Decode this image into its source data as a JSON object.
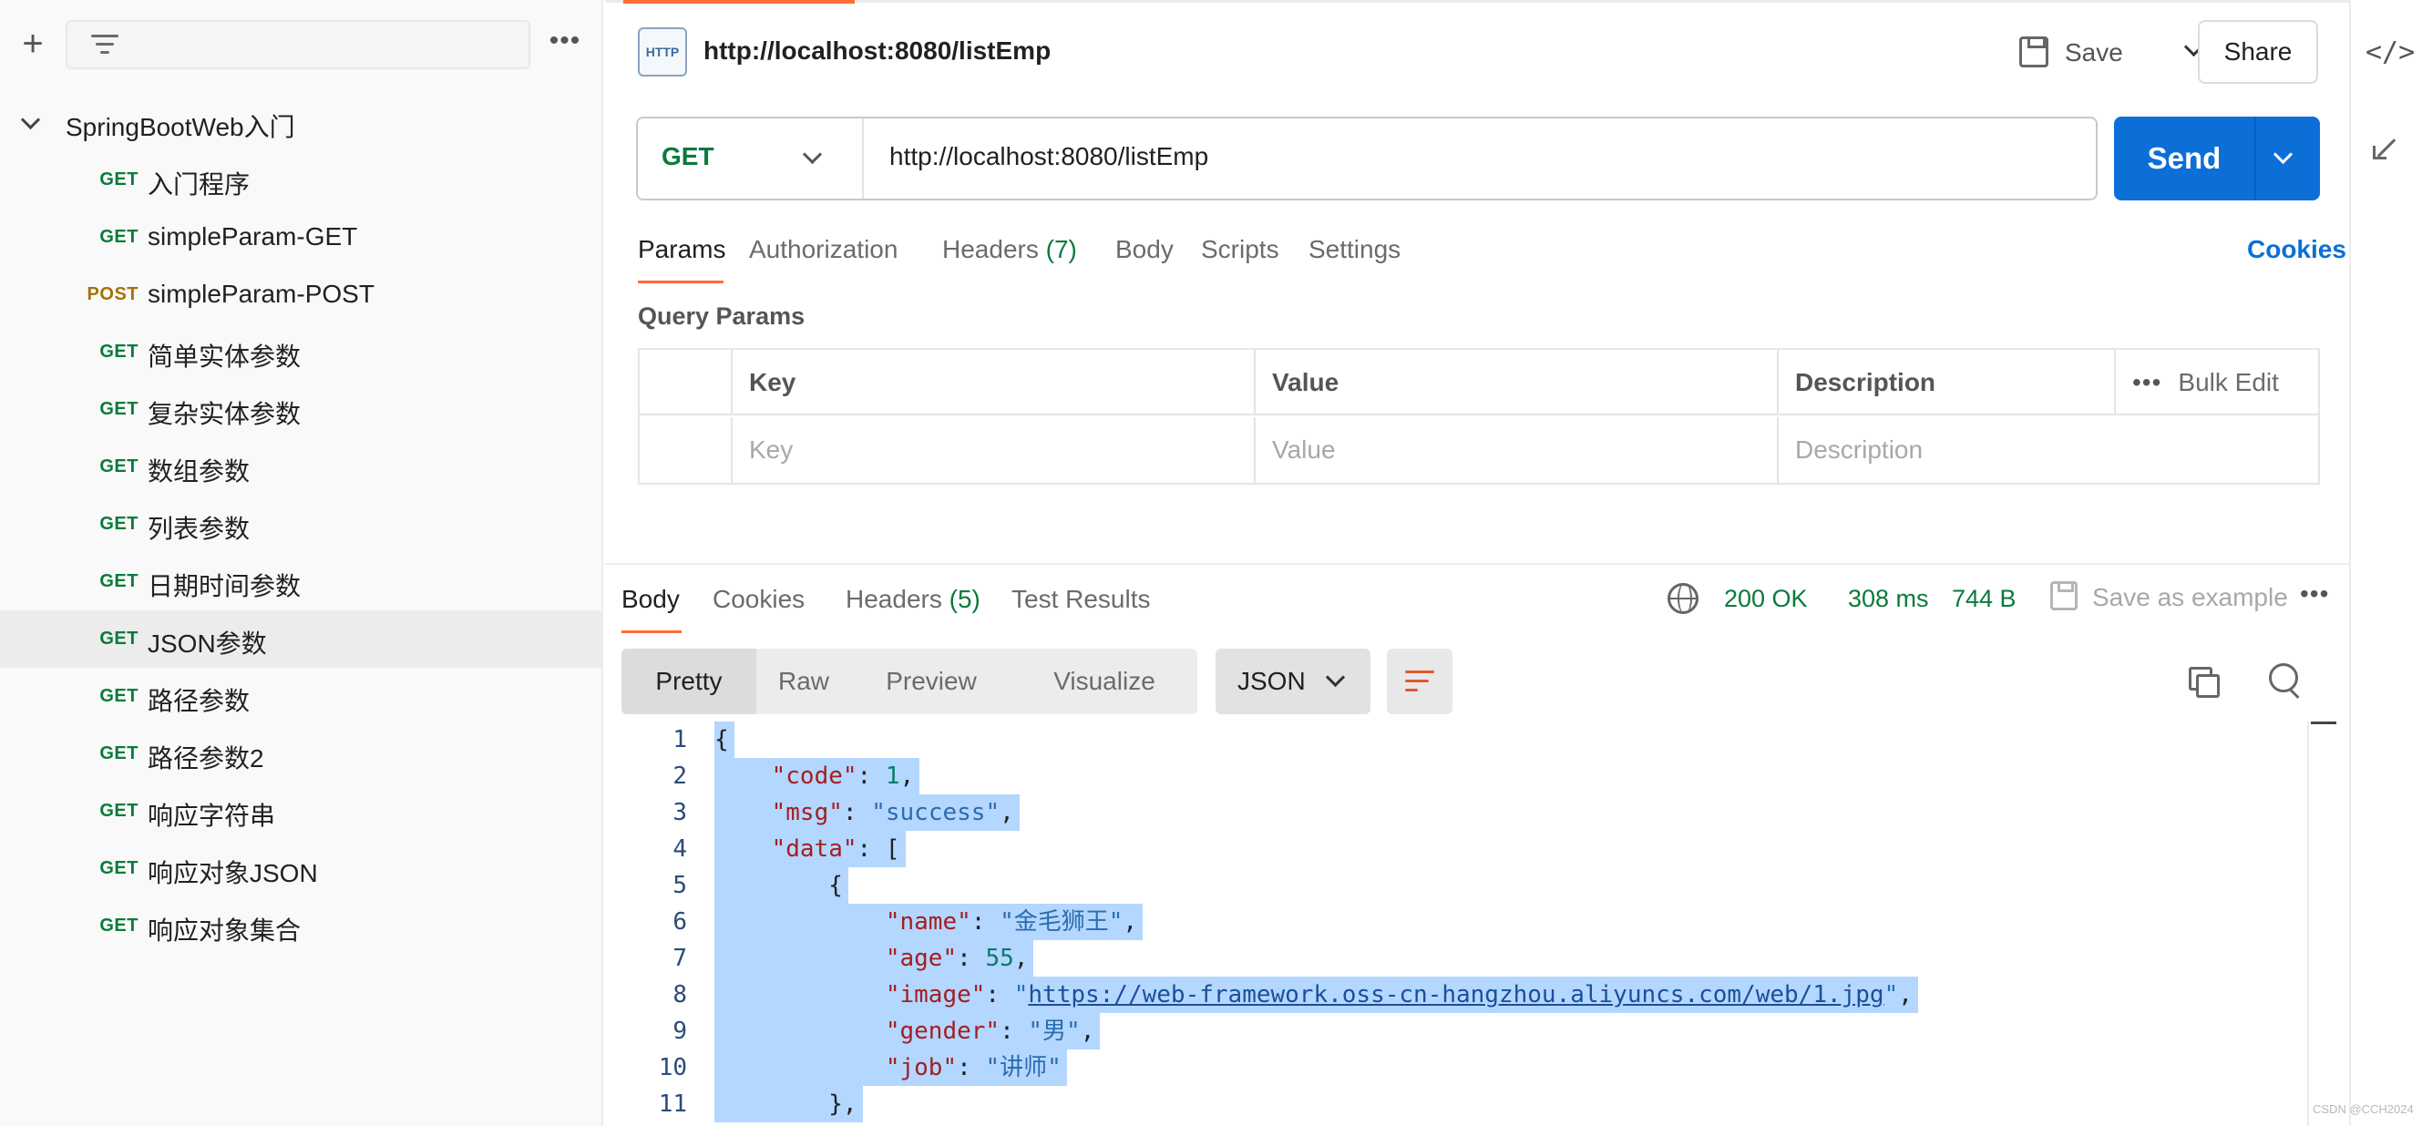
{
  "sidebar": {
    "collection_name": "SpringBootWeb入门",
    "items": [
      {
        "method": "GET",
        "name": "入门程序"
      },
      {
        "method": "GET",
        "name": "simpleParam-GET"
      },
      {
        "method": "POST",
        "name": "simpleParam-POST"
      },
      {
        "method": "GET",
        "name": "简单实体参数"
      },
      {
        "method": "GET",
        "name": "复杂实体参数"
      },
      {
        "method": "GET",
        "name": "数组参数"
      },
      {
        "method": "GET",
        "name": "列表参数"
      },
      {
        "method": "GET",
        "name": "日期时间参数"
      },
      {
        "method": "GET",
        "name": "JSON参数"
      },
      {
        "method": "GET",
        "name": "路径参数"
      },
      {
        "method": "GET",
        "name": "路径参数2"
      },
      {
        "method": "GET",
        "name": "响应字符串"
      },
      {
        "method": "GET",
        "name": "响应对象JSON"
      },
      {
        "method": "GET",
        "name": "响应对象集合"
      }
    ],
    "active_item": "JSON参数"
  },
  "header": {
    "icon_label": "HTTP",
    "title": "http://localhost:8080/listEmp",
    "save_label": "Save",
    "share_label": "Share"
  },
  "request": {
    "method": "GET",
    "url": "http://localhost:8080/listEmp",
    "send_label": "Send",
    "tabs": {
      "params": "Params",
      "authorization": "Authorization",
      "headers": "Headers",
      "headers_count": "(7)",
      "body": "Body",
      "scripts": "Scripts",
      "settings": "Settings",
      "cookies": "Cookies"
    }
  },
  "query_params": {
    "title": "Query Params",
    "columns": {
      "key": "Key",
      "value": "Value",
      "description": "Description",
      "bulk_edit": "Bulk Edit"
    },
    "placeholders": {
      "key": "Key",
      "value": "Value",
      "description": "Description"
    }
  },
  "response": {
    "tabs": {
      "body": "Body",
      "cookies": "Cookies",
      "headers": "Headers",
      "headers_count": "(5)",
      "test_results": "Test Results"
    },
    "status": "200 OK",
    "time": "308 ms",
    "size": "744 B",
    "save_example": "Save as example",
    "views": {
      "pretty": "Pretty",
      "raw": "Raw",
      "preview": "Preview",
      "visualize": "Visualize"
    },
    "format": "JSON",
    "code_lines": [
      {
        "n": "1",
        "indent": "",
        "tokens": [
          [
            "pun",
            "{"
          ]
        ]
      },
      {
        "n": "2",
        "indent": "    ",
        "tokens": [
          [
            "key",
            "\"code\""
          ],
          [
            "pun",
            ": "
          ],
          [
            "num",
            "1"
          ],
          [
            "pun",
            ","
          ]
        ]
      },
      {
        "n": "3",
        "indent": "    ",
        "tokens": [
          [
            "key",
            "\"msg\""
          ],
          [
            "pun",
            ": "
          ],
          [
            "str",
            "\"success\""
          ],
          [
            "pun",
            ","
          ]
        ]
      },
      {
        "n": "4",
        "indent": "    ",
        "tokens": [
          [
            "key",
            "\"data\""
          ],
          [
            "pun",
            ": ["
          ]
        ]
      },
      {
        "n": "5",
        "indent": "        ",
        "tokens": [
          [
            "pun",
            "{"
          ]
        ]
      },
      {
        "n": "6",
        "indent": "            ",
        "tokens": [
          [
            "key",
            "\"name\""
          ],
          [
            "pun",
            ": "
          ],
          [
            "str",
            "\"金毛狮王\""
          ],
          [
            "pun",
            ","
          ]
        ]
      },
      {
        "n": "7",
        "indent": "            ",
        "tokens": [
          [
            "key",
            "\"age\""
          ],
          [
            "pun",
            ": "
          ],
          [
            "num",
            "55"
          ],
          [
            "pun",
            ","
          ]
        ]
      },
      {
        "n": "8",
        "indent": "            ",
        "tokens": [
          [
            "key",
            "\"image\""
          ],
          [
            "pun",
            ": "
          ],
          [
            "str",
            "\""
          ],
          [
            "url",
            "https://web-framework.oss-cn-hangzhou.aliyuncs.com/web/1.jpg"
          ],
          [
            "str",
            "\""
          ],
          [
            "pun",
            ","
          ]
        ]
      },
      {
        "n": "9",
        "indent": "            ",
        "tokens": [
          [
            "key",
            "\"gender\""
          ],
          [
            "pun",
            ": "
          ],
          [
            "str",
            "\"男\""
          ],
          [
            "pun",
            ","
          ]
        ]
      },
      {
        "n": "10",
        "indent": "            ",
        "tokens": [
          [
            "key",
            "\"job\""
          ],
          [
            "pun",
            ": "
          ],
          [
            "str",
            "\"讲师\""
          ]
        ]
      },
      {
        "n": "11",
        "indent": "        ",
        "tokens": [
          [
            "pun",
            "},"
          ]
        ]
      }
    ]
  },
  "rail": {
    "code_icon": "</>"
  },
  "watermark": "CSDN @CCH2024",
  "colors": {
    "accent": "#ff6c37",
    "send": "#0c6fd8",
    "get": "#0a7a3b",
    "post": "#a5730b",
    "selection": "#b3d7ff"
  },
  "icons": [
    "plus-icon",
    "filter-icon",
    "more-icon",
    "chevron-down-icon",
    "http-icon",
    "save-icon",
    "globe-icon",
    "copy-icon",
    "search-icon",
    "wrap-icon",
    "code-icon",
    "collapse-icon"
  ]
}
